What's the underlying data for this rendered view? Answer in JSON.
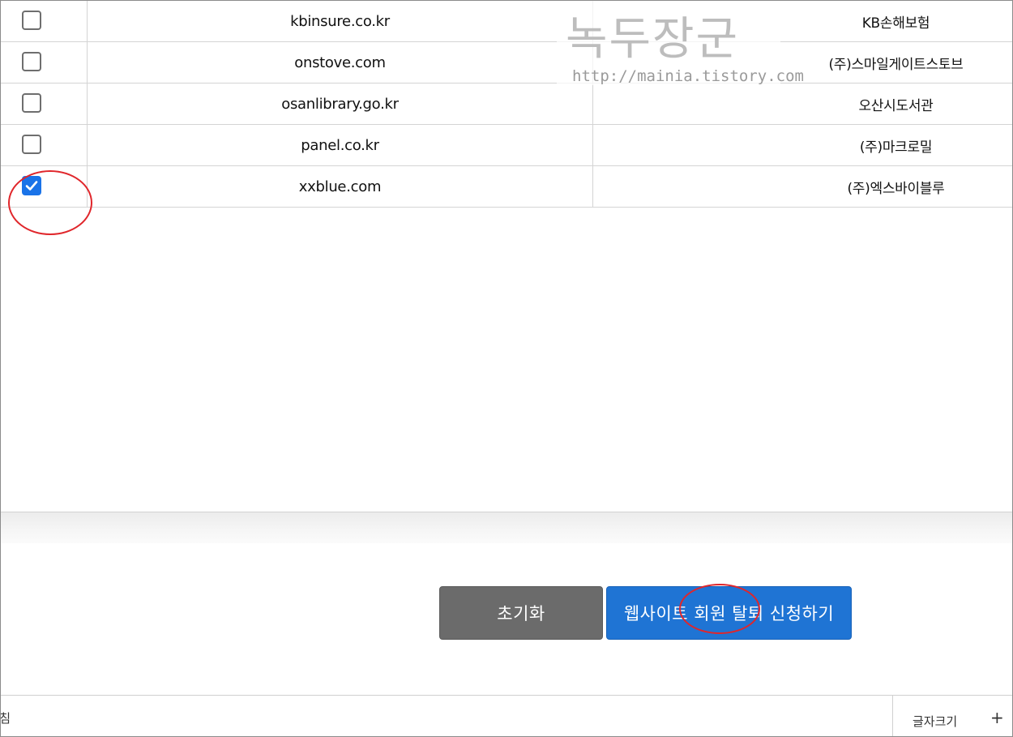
{
  "rows": [
    {
      "domain": "kbinsure.co.kr",
      "company": "KB손해보험",
      "checked": false
    },
    {
      "domain": "onstove.com",
      "company": "(주)스마일게이트스토브",
      "checked": false
    },
    {
      "domain": "osanlibrary.go.kr",
      "company": "오산시도서관",
      "checked": false
    },
    {
      "domain": "panel.co.kr",
      "company": "(주)마크로밀",
      "checked": false
    },
    {
      "domain": "xxblue.com",
      "company": "(주)엑스바이블루",
      "checked": true
    }
  ],
  "buttons": {
    "reset_label": "초기화",
    "withdraw_label": "웹사이트 회원 탈퇴 신청하기"
  },
  "footer": {
    "left_text": "침",
    "font_size_label": "글자크기",
    "font_increase_label": "+"
  },
  "watermark": {
    "title": "녹두장군",
    "url": "http://mainia.tistory.com"
  },
  "colors": {
    "accent": "#1f74d4",
    "reset_button": "#6b6b6b",
    "annotation": "#e0262b"
  }
}
